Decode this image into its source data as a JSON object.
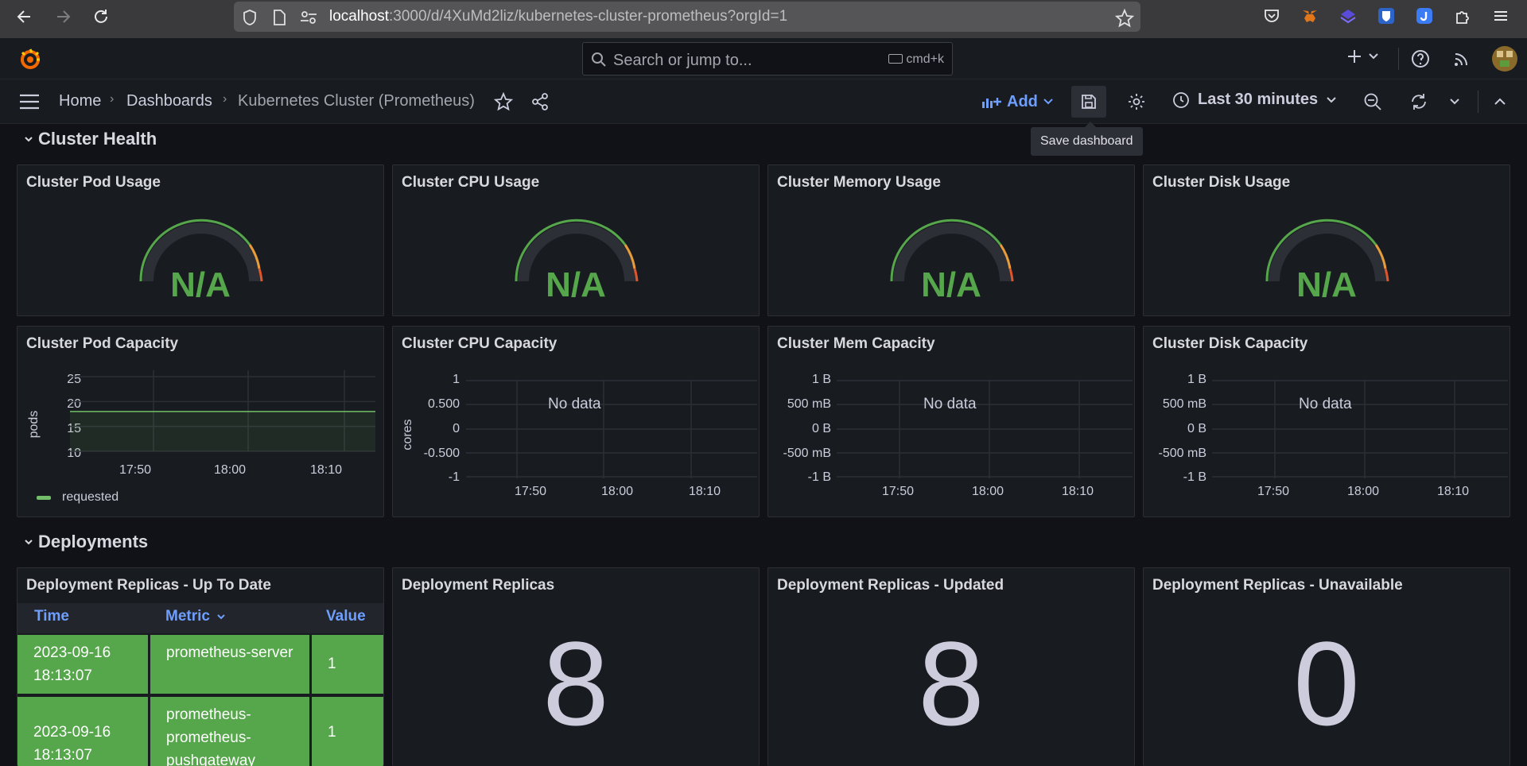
{
  "browser": {
    "url_host": "localhost",
    "url_rest": ":3000/d/4XuMd2liz/kubernetes-cluster-prometheus?orgId=1"
  },
  "topbar": {
    "search_placeholder": "Search or jump to...",
    "search_shortcut": "cmd+k"
  },
  "breadcrumb": {
    "items": [
      "Home",
      "Dashboards",
      "Kubernetes Cluster (Prometheus)"
    ]
  },
  "toolbar": {
    "add_label": "Add",
    "time_range": "Last 30 minutes",
    "save_tooltip": "Save dashboard"
  },
  "rows": {
    "cluster_health": "Cluster Health",
    "deployments": "Deployments"
  },
  "gauges": [
    {
      "title": "Cluster Pod Usage",
      "value": "N/A"
    },
    {
      "title": "Cluster CPU Usage",
      "value": "N/A"
    },
    {
      "title": "Cluster Memory Usage",
      "value": "N/A"
    },
    {
      "title": "Cluster Disk Usage",
      "value": "N/A"
    }
  ],
  "capacity": {
    "pod": {
      "title": "Cluster Pod Capacity",
      "ylabel": "pods",
      "yticks": [
        "25",
        "20",
        "15",
        "10"
      ],
      "xticks": [
        "17:50",
        "18:00",
        "18:10"
      ],
      "legend": "requested"
    },
    "cpu": {
      "title": "Cluster CPU Capacity",
      "ylabel": "cores",
      "yticks": [
        "1",
        "0.500",
        "0",
        "-0.500",
        "-1"
      ],
      "xticks": [
        "17:50",
        "18:00",
        "18:10"
      ],
      "no_data": "No data"
    },
    "mem": {
      "title": "Cluster Mem Capacity",
      "yticks": [
        "1 B",
        "500 mB",
        "0 B",
        "-500 mB",
        "-1 B"
      ],
      "xticks": [
        "17:50",
        "18:00",
        "18:10"
      ],
      "no_data": "No data"
    },
    "disk": {
      "title": "Cluster Disk Capacity",
      "yticks": [
        "1 B",
        "500 mB",
        "0 B",
        "-500 mB",
        "-1 B"
      ],
      "xticks": [
        "17:50",
        "18:00",
        "18:10"
      ],
      "no_data": "No data"
    }
  },
  "chart_data": {
    "type": "line",
    "title": "Cluster Pod Capacity",
    "ylabel": "pods",
    "ylim": [
      10,
      25
    ],
    "x": [
      "17:45",
      "18:13"
    ],
    "series": [
      {
        "name": "requested",
        "values": [
          18,
          18
        ]
      }
    ],
    "grid": true,
    "legend": "bottom-left"
  },
  "deployments": {
    "table": {
      "title": "Deployment Replicas - Up To Date",
      "headers": [
        "Time",
        "Metric",
        "Value"
      ],
      "rows": [
        [
          "2023-09-16 18:13:07",
          "prometheus-server",
          "1"
        ],
        [
          "2023-09-16 18:13:07",
          "prometheus-prometheus-pushgateway",
          "1"
        ]
      ]
    },
    "replicas": {
      "title": "Deployment Replicas",
      "value": "8"
    },
    "updated": {
      "title": "Deployment Replicas - Updated",
      "value": "8"
    },
    "unavailable": {
      "title": "Deployment Replicas - Unavailable",
      "value": "0"
    }
  },
  "colors": {
    "accent": "#6e9fff",
    "ok": "#56a64b",
    "background": "#111217",
    "panel": "#181b1f"
  }
}
